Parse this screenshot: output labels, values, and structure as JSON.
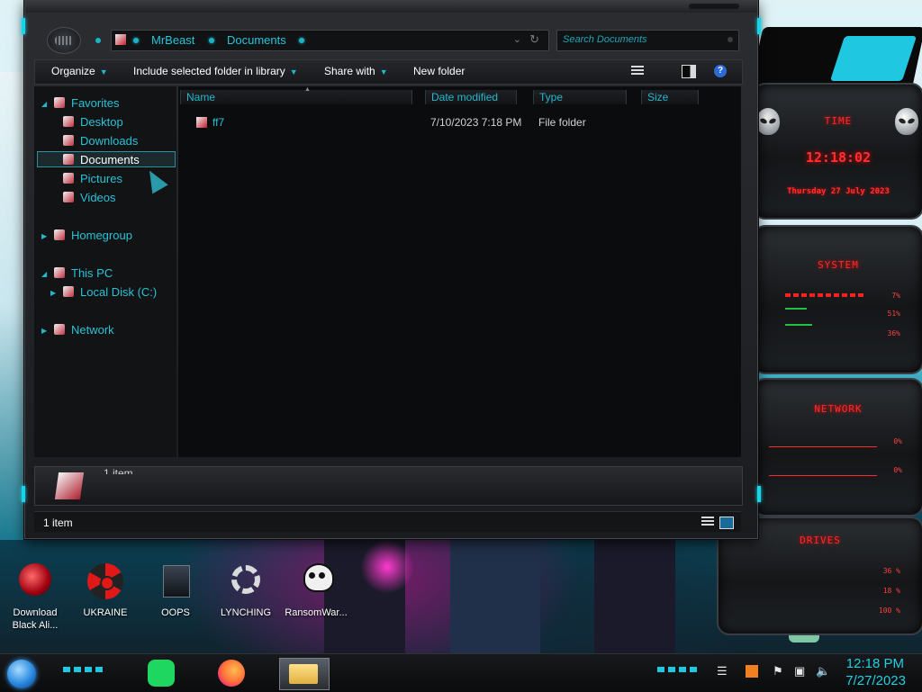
{
  "explorer": {
    "breadcrumb": [
      "MrBeast",
      "Documents"
    ],
    "search_placeholder": "Search Documents",
    "toolbar": {
      "organize": "Organize",
      "include": "Include selected folder in library",
      "share": "Share with",
      "new_folder": "New folder"
    },
    "nav": {
      "favorites": "Favorites",
      "desktop": "Desktop",
      "downloads": "Downloads",
      "documents": "Documents",
      "pictures": "Pictures",
      "videos": "Videos",
      "homegroup": "Homegroup",
      "this_pc": "This PC",
      "local_disk": "Local Disk (C:)",
      "network": "Network"
    },
    "columns": {
      "name": "Name",
      "date": "Date modified",
      "type": "Type",
      "size": "Size"
    },
    "files": [
      {
        "name": "ff7",
        "date": "7/10/2023 7:18 PM",
        "type": "File folder",
        "size": ""
      }
    ],
    "details_count": "1 item",
    "status": "1 item"
  },
  "gadgets": {
    "time_title": "TIME",
    "time_value": "12:18:02",
    "date_value": "Thursday 27 July 2023",
    "system_title": "SYSTEM",
    "system_values": [
      "7%",
      "51%",
      "36%"
    ],
    "network_title": "NETWORK",
    "network_values": [
      "0%",
      "0%"
    ],
    "drives_title": "DRIVES",
    "drives_values": [
      "36 %",
      "18 %",
      "100 %"
    ],
    "accent_color": "#ff2a2a"
  },
  "desktop_icons": [
    {
      "label": "Download Black Ali..."
    },
    {
      "label": "UKRAINE"
    },
    {
      "label": "OOPS"
    },
    {
      "label": "LYNCHING"
    },
    {
      "label": "RansomWar..."
    }
  ],
  "taskbar": {
    "time": "12:18 PM",
    "date": "7/27/2023",
    "accent_color": "#1ed0e4"
  }
}
